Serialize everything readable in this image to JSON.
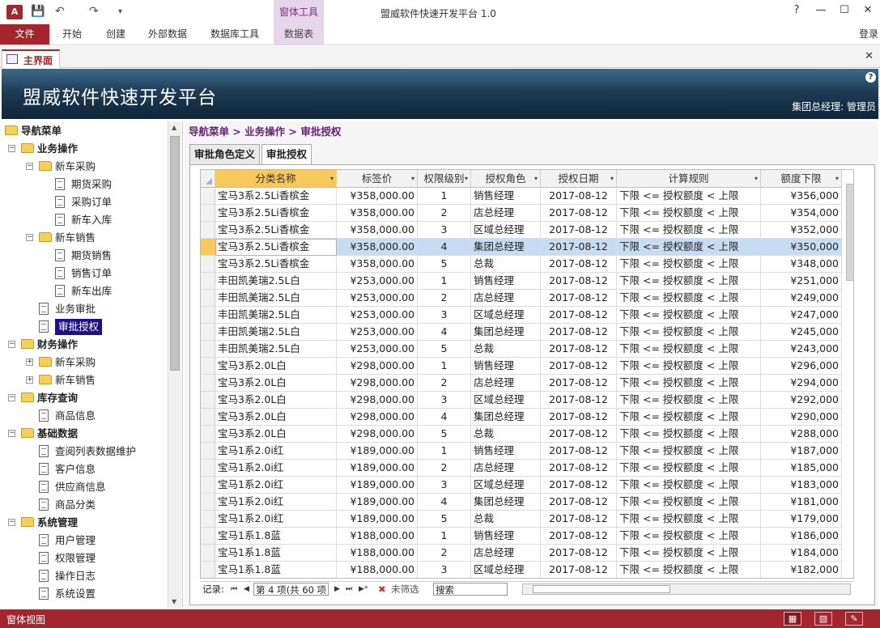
{
  "app": {
    "icon_label": "A",
    "window_title": "盟威软件快速开发平台 1.0",
    "context_tool": "窗体工具",
    "help": "?",
    "minimize": "—",
    "restore": "☐",
    "close": "✕"
  },
  "ribbon": {
    "tabs": [
      "文件",
      "开始",
      "创建",
      "外部数据",
      "数据库工具",
      "数据表"
    ],
    "signin": "登录"
  },
  "document_tab": {
    "label": "主界面",
    "close": "✕"
  },
  "banner": {
    "title": "盟威软件快速开发平台",
    "user": "集团总经理: 管理员",
    "help": "?"
  },
  "nav": {
    "items": [
      {
        "label": "导航菜单",
        "level": 0,
        "kind": "folder",
        "bold": true
      },
      {
        "label": "业务操作",
        "level": 1,
        "kind": "folder",
        "bold": true,
        "expander": "−"
      },
      {
        "label": "新车采购",
        "level": 2,
        "kind": "folder",
        "expander": "−"
      },
      {
        "label": "期货采购",
        "level": 3,
        "kind": "doc"
      },
      {
        "label": "采购订单",
        "level": 3,
        "kind": "doc"
      },
      {
        "label": "新车入库",
        "level": 3,
        "kind": "doc"
      },
      {
        "label": "新车销售",
        "level": 2,
        "kind": "folder",
        "expander": "−"
      },
      {
        "label": "期货销售",
        "level": 3,
        "kind": "doc"
      },
      {
        "label": "销售订单",
        "level": 3,
        "kind": "doc"
      },
      {
        "label": "新车出库",
        "level": 3,
        "kind": "doc"
      },
      {
        "label": "业务审批",
        "level": 2,
        "kind": "doc"
      },
      {
        "label": "审批授权",
        "level": 2,
        "kind": "doc",
        "selected": true
      },
      {
        "label": "财务操作",
        "level": 1,
        "kind": "folder",
        "bold": true,
        "expander": "−"
      },
      {
        "label": "新车采购",
        "level": 2,
        "kind": "folder",
        "expander": "+"
      },
      {
        "label": "新车销售",
        "level": 2,
        "kind": "folder",
        "expander": "+"
      },
      {
        "label": "库存查询",
        "level": 1,
        "kind": "folder",
        "bold": true,
        "expander": "−"
      },
      {
        "label": "商品信息",
        "level": 2,
        "kind": "doc"
      },
      {
        "label": "基础数据",
        "level": 1,
        "kind": "folder",
        "bold": true,
        "expander": "−"
      },
      {
        "label": "查阅列表数据维护",
        "level": 2,
        "kind": "doc"
      },
      {
        "label": "客户信息",
        "level": 2,
        "kind": "doc"
      },
      {
        "label": "供应商信息",
        "level": 2,
        "kind": "doc"
      },
      {
        "label": "商品分类",
        "level": 2,
        "kind": "doc"
      },
      {
        "label": "系统管理",
        "level": 1,
        "kind": "folder",
        "bold": true,
        "expander": "−"
      },
      {
        "label": "用户管理",
        "level": 2,
        "kind": "doc"
      },
      {
        "label": "权限管理",
        "level": 2,
        "kind": "doc"
      },
      {
        "label": "操作日志",
        "level": 2,
        "kind": "doc"
      },
      {
        "label": "系统设置",
        "level": 2,
        "kind": "doc"
      }
    ]
  },
  "main": {
    "breadcrumb": "导航菜单 > 业务操作 > 审批授权",
    "tabs": [
      "审批角色定义",
      "审批授权"
    ],
    "active_tab": 1,
    "columns": [
      "分类名称",
      "标签价",
      "权限级别",
      "授权角色",
      "授权日期",
      "计算规则",
      "额度下限"
    ],
    "current_row": 3,
    "rows": [
      [
        "宝马3系2.5Li香槟金",
        "¥358,000.00",
        "1",
        "销售经理",
        "2017-08-12",
        "下限 <= 授权额度 < 上限",
        "¥356,000"
      ],
      [
        "宝马3系2.5Li香槟金",
        "¥358,000.00",
        "2",
        "店总经理",
        "2017-08-12",
        "下限 <= 授权额度 < 上限",
        "¥354,000"
      ],
      [
        "宝马3系2.5Li香槟金",
        "¥358,000.00",
        "3",
        "区域总经理",
        "2017-08-12",
        "下限 <= 授权额度 < 上限",
        "¥352,000"
      ],
      [
        "宝马3系2.5Li香槟金",
        "¥358,000.00",
        "4",
        "集团总经理",
        "2017-08-12",
        "下限 <= 授权额度 < 上限",
        "¥350,000"
      ],
      [
        "宝马3系2.5Li香槟金",
        "¥358,000.00",
        "5",
        "总裁",
        "2017-08-12",
        "下限 <= 授权额度 < 上限",
        "¥348,000"
      ],
      [
        "丰田凯美瑞2.5L白",
        "¥253,000.00",
        "1",
        "销售经理",
        "2017-08-12",
        "下限 <= 授权额度 < 上限",
        "¥251,000"
      ],
      [
        "丰田凯美瑞2.5L白",
        "¥253,000.00",
        "2",
        "店总经理",
        "2017-08-12",
        "下限 <= 授权额度 < 上限",
        "¥249,000"
      ],
      [
        "丰田凯美瑞2.5L白",
        "¥253,000.00",
        "3",
        "区域总经理",
        "2017-08-12",
        "下限 <= 授权额度 < 上限",
        "¥247,000"
      ],
      [
        "丰田凯美瑞2.5L白",
        "¥253,000.00",
        "4",
        "集团总经理",
        "2017-08-12",
        "下限 <= 授权额度 < 上限",
        "¥245,000"
      ],
      [
        "丰田凯美瑞2.5L白",
        "¥253,000.00",
        "5",
        "总裁",
        "2017-08-12",
        "下限 <= 授权额度 < 上限",
        "¥243,000"
      ],
      [
        "宝马3系2.0L白",
        "¥298,000.00",
        "1",
        "销售经理",
        "2017-08-12",
        "下限 <= 授权额度 < 上限",
        "¥296,000"
      ],
      [
        "宝马3系2.0L白",
        "¥298,000.00",
        "2",
        "店总经理",
        "2017-08-12",
        "下限 <= 授权额度 < 上限",
        "¥294,000"
      ],
      [
        "宝马3系2.0L白",
        "¥298,000.00",
        "3",
        "区域总经理",
        "2017-08-12",
        "下限 <= 授权额度 < 上限",
        "¥292,000"
      ],
      [
        "宝马3系2.0L白",
        "¥298,000.00",
        "4",
        "集团总经理",
        "2017-08-12",
        "下限 <= 授权额度 < 上限",
        "¥290,000"
      ],
      [
        "宝马3系2.0L白",
        "¥298,000.00",
        "5",
        "总裁",
        "2017-08-12",
        "下限 <= 授权额度 < 上限",
        "¥288,000"
      ],
      [
        "宝马1系2.0i红",
        "¥189,000.00",
        "1",
        "销售经理",
        "2017-08-12",
        "下限 <= 授权额度 < 上限",
        "¥187,000"
      ],
      [
        "宝马1系2.0i红",
        "¥189,000.00",
        "2",
        "店总经理",
        "2017-08-12",
        "下限 <= 授权额度 < 上限",
        "¥185,000"
      ],
      [
        "宝马1系2.0i红",
        "¥189,000.00",
        "3",
        "区域总经理",
        "2017-08-12",
        "下限 <= 授权额度 < 上限",
        "¥183,000"
      ],
      [
        "宝马1系2.0i红",
        "¥189,000.00",
        "4",
        "集团总经理",
        "2017-08-12",
        "下限 <= 授权额度 < 上限",
        "¥181,000"
      ],
      [
        "宝马1系2.0i红",
        "¥189,000.00",
        "5",
        "总裁",
        "2017-08-12",
        "下限 <= 授权额度 < 上限",
        "¥179,000"
      ],
      [
        "宝马1系1.8蓝",
        "¥188,000.00",
        "1",
        "销售经理",
        "2017-08-12",
        "下限 <= 授权额度 < 上限",
        "¥186,000"
      ],
      [
        "宝马1系1.8蓝",
        "¥188,000.00",
        "2",
        "店总经理",
        "2017-08-12",
        "下限 <= 授权额度 < 上限",
        "¥184,000"
      ],
      [
        "宝马1系1.8蓝",
        "¥188,000.00",
        "3",
        "区域总经理",
        "2017-08-12",
        "下限 <= 授权额度 < 上限",
        "¥182,000"
      ]
    ],
    "record_nav": {
      "label": "记录:",
      "position": "第 4 项(共 60 项",
      "filter": "未筛选",
      "search": "搜索"
    }
  },
  "status": {
    "label": "窗体视图"
  }
}
